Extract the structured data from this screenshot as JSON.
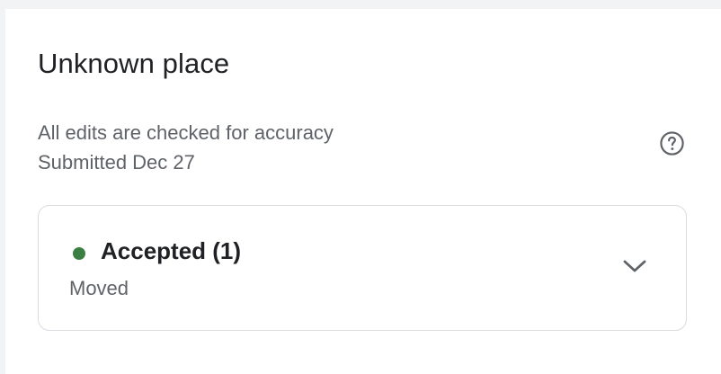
{
  "place": {
    "title": "Unknown place",
    "note": "All edits are checked for accuracy",
    "submitted": "Submitted Dec 27"
  },
  "status_card": {
    "status_label": "Accepted (1)",
    "status_color": "#3c7f43",
    "change_type": "Moved",
    "expand_icon": "chevron-down-icon"
  },
  "icons": {
    "help": "help-circle-icon"
  },
  "colors": {
    "background": "#f1f3f4",
    "panel": "#ffffff",
    "primary_text": "#202124",
    "secondary_text": "#5f6368",
    "border": "#dadce0"
  }
}
